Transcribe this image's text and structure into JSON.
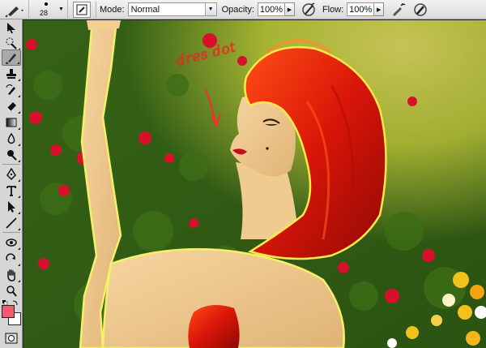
{
  "options_bar": {
    "brush_size": "28",
    "mode_label": "Mode:",
    "mode_value": "Normal",
    "opacity_label": "Opacity:",
    "opacity_value": "100%",
    "flow_label": "Flow:",
    "flow_value": "100%"
  },
  "colors": {
    "foreground": "#f25c6e",
    "background": "#ffffff",
    "accent_annotation": "#ff2a2a"
  },
  "tools": [
    "move-icon",
    "quick-selection-icon",
    "brush-icon",
    "clone-stamp-icon",
    "history-brush-icon",
    "eraser-icon",
    "gradient-icon",
    "blur-icon",
    "dodge-icon",
    "pen-icon",
    "type-icon",
    "path-selection-icon",
    "line-icon",
    "3d-rotate-icon",
    "3d-orbit-icon",
    "hand-icon",
    "zoom-icon"
  ],
  "canvas": {
    "annotation": "dres dot"
  }
}
